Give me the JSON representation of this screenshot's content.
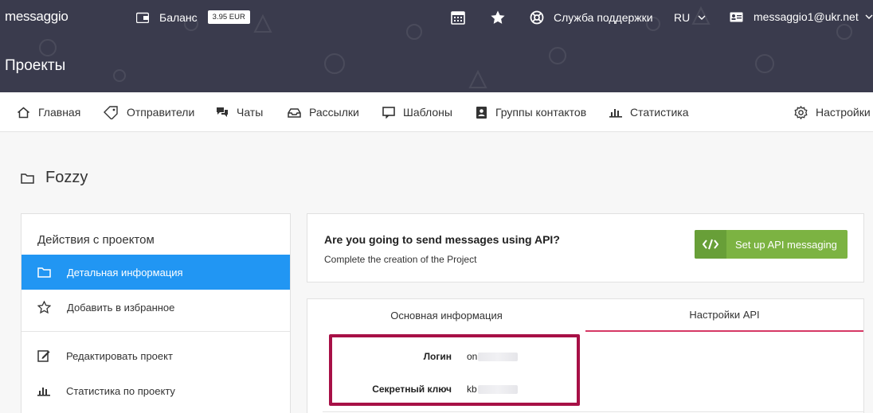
{
  "header": {
    "logo": "messaggio",
    "balance_label": "Баланс",
    "balance_value": "3.95 EUR",
    "support_label": "Служба поддержки",
    "language": "RU",
    "account_email": "messaggio1@ukr.net",
    "page_title": "Проекты"
  },
  "nav": {
    "items": [
      {
        "label": "Главная",
        "icon": "home-icon"
      },
      {
        "label": "Отправители",
        "icon": "tag-icon"
      },
      {
        "label": "Чаты",
        "icon": "chat-icon"
      },
      {
        "label": "Рассылки",
        "icon": "inbox-icon"
      },
      {
        "label": "Шаблоны",
        "icon": "template-icon"
      },
      {
        "label": "Группы контактов",
        "icon": "contacts-icon"
      },
      {
        "label": "Статистика",
        "icon": "chart-icon"
      },
      {
        "label": "Настройки",
        "icon": "gear-icon"
      }
    ]
  },
  "project": {
    "name": "Fozzy"
  },
  "sidebar": {
    "title": "Действия с проектом",
    "items": [
      {
        "label": "Детальная информация",
        "icon": "folder-icon",
        "active": true
      },
      {
        "label": "Добавить в избранное",
        "icon": "star-icon",
        "active": false
      },
      {
        "label": "Редактировать проект",
        "icon": "edit-icon",
        "active": false
      },
      {
        "label": "Статистика по проекту",
        "icon": "chart-icon",
        "active": false
      }
    ]
  },
  "api_card": {
    "title": "Are you going to send messages using API?",
    "subtitle": "Complete the creation of the Project",
    "button_label": "Set up API messaging"
  },
  "info": {
    "tabs": [
      {
        "label": "Основная информация",
        "active": false
      },
      {
        "label": "Настройки API",
        "active": true
      }
    ],
    "fields": [
      {
        "label": "Логин",
        "value": "on"
      },
      {
        "label": "Секретный ключ",
        "value": "kb"
      }
    ]
  },
  "colors": {
    "header_bg": "#3a3b4d",
    "active_blue": "#2196f3",
    "button_green": "#7cb342",
    "tab_accent": "#d63865",
    "highlight": "#a71046"
  }
}
